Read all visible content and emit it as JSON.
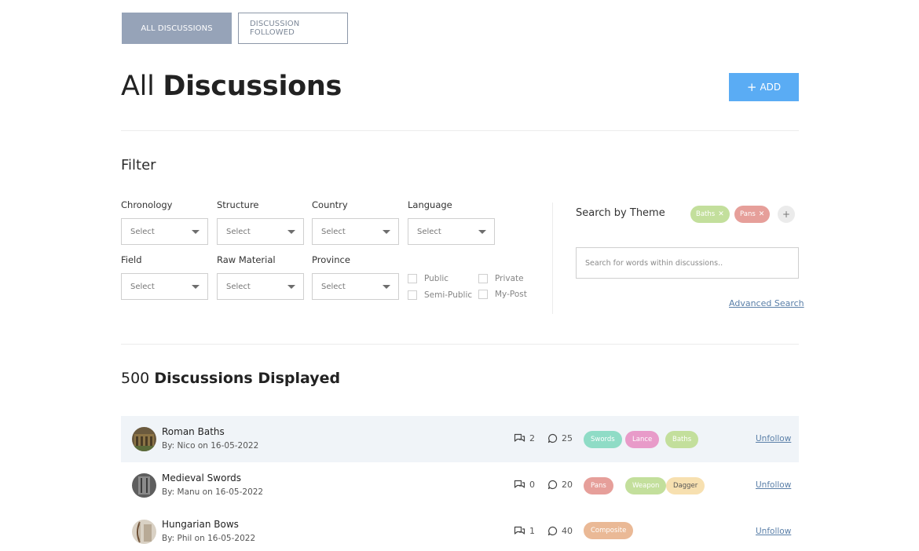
{
  "tabs": [
    {
      "label": "ALL DISCUSSIONS",
      "active": true
    },
    {
      "label": "DISCUSSION FOLLOWED",
      "active": false
    }
  ],
  "header": {
    "title_light": "All",
    "title_bold": "Discussions",
    "add_label": "ADD",
    "add_icon": "+"
  },
  "filter": {
    "title": "Filter",
    "fields": {
      "chronology": {
        "label": "Chronology",
        "value": "Select"
      },
      "structure": {
        "label": "Structure",
        "value": "Select"
      },
      "country": {
        "label": "Country",
        "value": "Select"
      },
      "language": {
        "label": "Language",
        "value": "Select"
      },
      "field": {
        "label": "Field",
        "value": "Select"
      },
      "raw_material": {
        "label": "Raw Material",
        "value": "Select"
      },
      "province": {
        "label": "Province",
        "value": "Select"
      }
    },
    "visibility": {
      "public": "Public",
      "private": "Private",
      "semi_public": "Semi-Public",
      "my_post": "My-Post"
    },
    "theme": {
      "label": "Search by Theme",
      "chips": [
        {
          "label": "Baths",
          "color": "#c3df9c"
        },
        {
          "label": "Pans",
          "color": "#e69f9a"
        }
      ],
      "add_icon": "+"
    },
    "search_placeholder": "Search for words within discussions..",
    "advanced_label": "Advanced Search"
  },
  "list": {
    "count": "500",
    "count_label": "Discussions Displayed",
    "rows": [
      {
        "title": "Roman Baths",
        "byline": "By: Nico on 16-05-2022",
        "threads": "2",
        "comments": "25",
        "tags": [
          {
            "label": "Swords",
            "color": "#8fdcc6"
          },
          {
            "label": "Lance",
            "color": "#e89bc9"
          },
          {
            "label": "Baths",
            "color": "#c3df9c"
          }
        ],
        "action": "Unfollow"
      },
      {
        "title": "Medieval Swords",
        "byline": "By: Manu on 16-05-2022",
        "threads": "0",
        "comments": "20",
        "tags": [
          {
            "label": "Pans",
            "color": "#e69f9a"
          },
          {
            "label": "Weapon",
            "color": "#c3df9c"
          },
          {
            "label": "Dagger",
            "color": "#f7e0b0"
          }
        ],
        "action": "Unfollow"
      },
      {
        "title": "Hungarian Bows",
        "byline": "By: Phil on 16-05-2022",
        "threads": "1",
        "comments": "40",
        "tags": [
          {
            "label": "Composite",
            "color": "#eab996"
          }
        ],
        "action": "Unfollow"
      }
    ]
  },
  "colors": {
    "accent": "#5aacf4",
    "tab_active": "#96a3b8",
    "row_alt": "#f0f4f8",
    "link": "#5a7fa8"
  }
}
